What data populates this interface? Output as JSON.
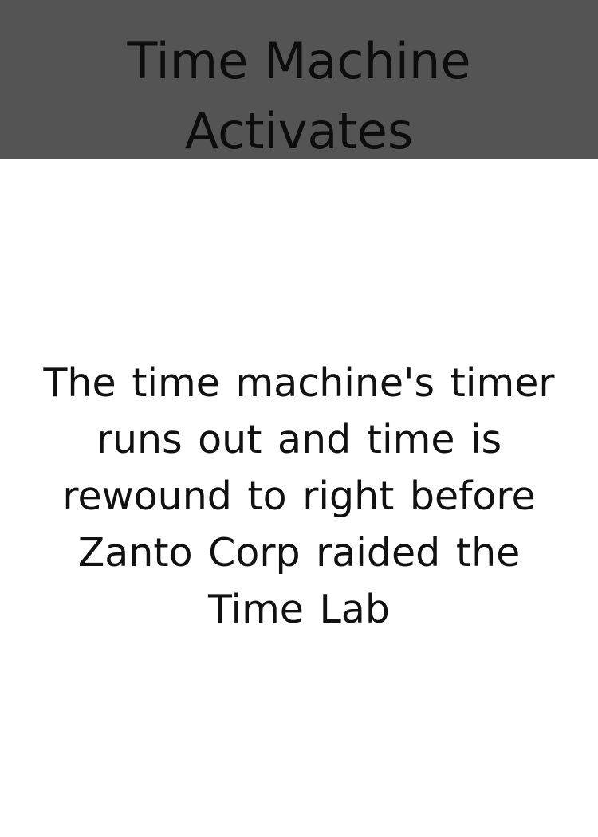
{
  "card": {
    "title": "Time Machine Activates",
    "description": "The time machine's timer runs out and time is rewound to right before Zanto Corp raided the Time Lab"
  },
  "colors": {
    "header_background": "#545454",
    "card_background": "#ffffff",
    "text": "#111111"
  }
}
